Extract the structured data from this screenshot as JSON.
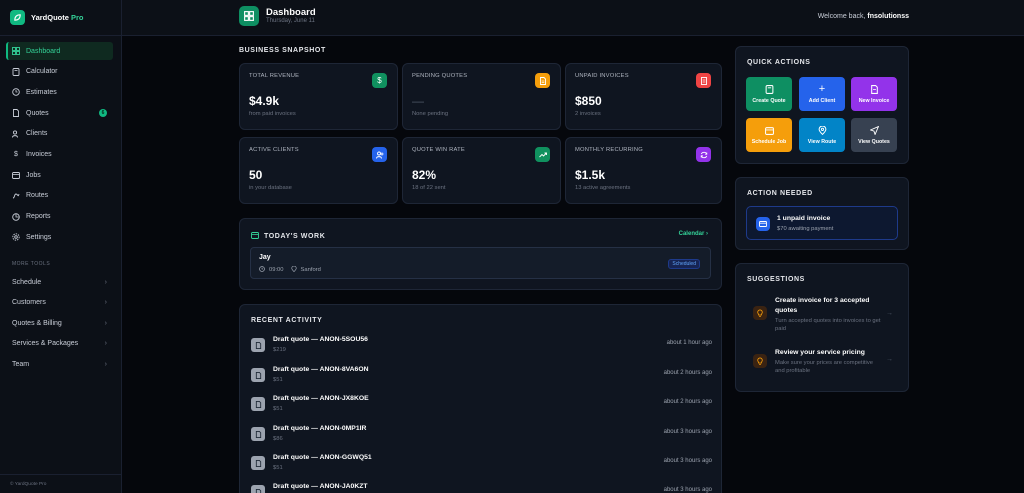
{
  "brand": {
    "name": "YardQuote",
    "suffix": "Pro"
  },
  "sidebar": {
    "items": [
      {
        "label": "Dashboard",
        "icon": "grid-icon"
      },
      {
        "label": "Calculator",
        "icon": "calculator-icon"
      },
      {
        "label": "Estimates",
        "icon": "clock-icon"
      },
      {
        "label": "Quotes",
        "icon": "document-icon",
        "badge": "6"
      },
      {
        "label": "Clients",
        "icon": "users-icon"
      },
      {
        "label": "Invoices",
        "icon": "dollar-icon"
      },
      {
        "label": "Jobs",
        "icon": "calendar-icon"
      },
      {
        "label": "Routes",
        "icon": "route-icon"
      },
      {
        "label": "Reports",
        "icon": "chart-icon"
      },
      {
        "label": "Settings",
        "icon": "gear-icon"
      }
    ],
    "more_tools_label": "MORE TOOLS",
    "more_tools": [
      "Schedule",
      "Customers",
      "Quotes & Billing",
      "Services & Packages",
      "Team"
    ],
    "footer": "© YardQuote Pro"
  },
  "header": {
    "title": "Dashboard",
    "date": "Thursday, June 11",
    "welcome_prefix": "Welcome back,",
    "username": "fnsolutionss"
  },
  "snapshot": {
    "title": "BUSINESS SNAPSHOT",
    "cards": [
      {
        "label": "TOTAL REVENUE",
        "value": "$4.9k",
        "sub": "from paid invoices",
        "icon": "dollar-icon",
        "color": "#10915f"
      },
      {
        "label": "PENDING QUOTES",
        "value": "—",
        "sub": "None pending",
        "icon": "document-icon",
        "color": "#f59e0b"
      },
      {
        "label": "UNPAID INVOICES",
        "value": "$850",
        "sub": "2 invoices",
        "icon": "receipt-icon",
        "color": "#ef4444"
      },
      {
        "label": "ACTIVE CLIENTS",
        "value": "50",
        "sub": "in your database",
        "icon": "users-icon",
        "color": "#2563eb"
      },
      {
        "label": "QUOTE WIN RATE",
        "value": "82%",
        "sub": "18 of 22 sent",
        "icon": "trend-up-icon",
        "color": "#10915f"
      },
      {
        "label": "MONTHLY RECURRING",
        "value": "$1.5k",
        "sub": "13 active agreements",
        "icon": "refresh-icon",
        "color": "#9333ea"
      }
    ]
  },
  "todays_work": {
    "title": "TODAY'S WORK",
    "calendar_link": "Calendar",
    "jobs": [
      {
        "name": "Jay",
        "time": "09:00",
        "location": "Sanford",
        "status": "Scheduled"
      }
    ]
  },
  "recent_activity": {
    "title": "RECENT ACTIVITY",
    "items": [
      {
        "title": "Draft quote — ANON-5SOU56",
        "amount": "$219",
        "time": "about 1 hour ago"
      },
      {
        "title": "Draft quote — ANON-8VA6ON",
        "amount": "$51",
        "time": "about 2 hours ago"
      },
      {
        "title": "Draft quote — ANON-JX8KOE",
        "amount": "$51",
        "time": "about 2 hours ago"
      },
      {
        "title": "Draft quote — ANON-0MP1IR",
        "amount": "$86",
        "time": "about 3 hours ago"
      },
      {
        "title": "Draft quote — ANON-GGWQ51",
        "amount": "$51",
        "time": "about 3 hours ago"
      },
      {
        "title": "Draft quote — ANON-JA0KZT",
        "amount": "",
        "time": "about 3 hours ago"
      }
    ]
  },
  "quick_actions": {
    "title": "QUICK ACTIONS",
    "buttons": [
      {
        "label": "Create Quote",
        "icon": "calculator-icon",
        "color": "#0e8f62"
      },
      {
        "label": "Add Client",
        "icon": "plus-icon",
        "color": "#2563eb"
      },
      {
        "label": "New Invoice",
        "icon": "document-icon",
        "color": "#9333ea"
      },
      {
        "label": "Schedule Job",
        "icon": "calendar-icon",
        "color": "#f59e0b"
      },
      {
        "label": "View Route",
        "icon": "map-pin-icon",
        "color": "#0284c7"
      },
      {
        "label": "View Quotes",
        "icon": "send-icon",
        "color": "#374151"
      }
    ]
  },
  "action_needed": {
    "title": "ACTION NEEDED",
    "alert_title": "1 unpaid invoice",
    "alert_sub": "$70 awaiting payment"
  },
  "suggestions": {
    "title": "SUGGESTIONS",
    "items": [
      {
        "title": "Create invoice for 3 accepted quotes",
        "desc": "Turn accepted quotes into invoices to get paid"
      },
      {
        "title": "Review your service pricing",
        "desc": "Make sure your prices are competitive and profitable"
      }
    ]
  }
}
